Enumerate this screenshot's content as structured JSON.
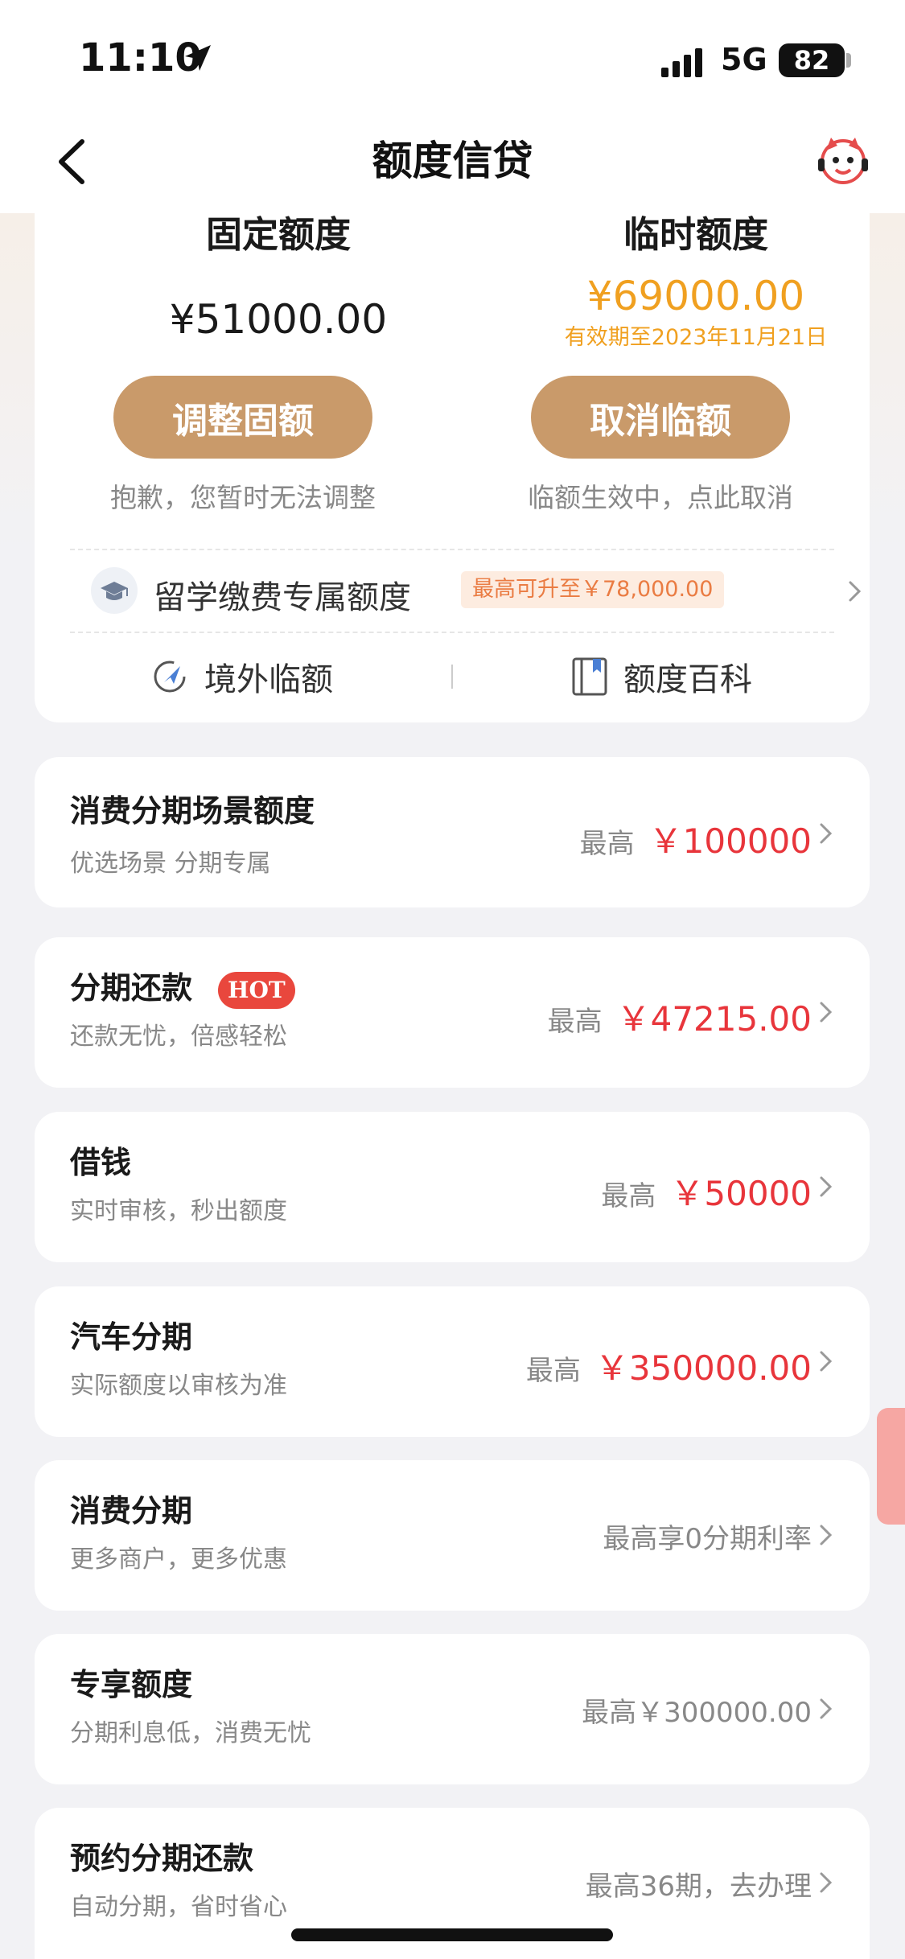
{
  "status_bar": {
    "time": "11:10",
    "network": "5G",
    "battery": "82",
    "icons": [
      "location-arrow-icon",
      "signal-icon",
      "battery-icon"
    ]
  },
  "nav": {
    "title": "额度信贷",
    "icons": [
      "back-chevron-icon",
      "assistant-mascot-icon"
    ]
  },
  "quota": {
    "fixed": {
      "label": "固定额度",
      "amount": "¥51000.00",
      "button": "调整固额",
      "note": "抱歉，您暂时无法调整"
    },
    "temporary": {
      "label": "临时额度",
      "amount": "¥69000.00",
      "expiry": "有效期至2023年11月21日",
      "button": "取消临额",
      "note": "临额生效中，点此取消"
    },
    "study_abroad": {
      "label": "留学缴费专属额度",
      "badge": "最高可升至￥78,000.00"
    },
    "tools": {
      "overseas": "境外临额",
      "wiki": "额度百科"
    }
  },
  "entries": [
    {
      "title": "消费分期场景额度",
      "subtitle": "优选场景 分期专属",
      "prefix": "最高",
      "amount": "￥100000"
    },
    {
      "title": "分期还款",
      "badge": "HOT",
      "subtitle": "还款无忧，倍感轻松",
      "prefix": "最高",
      "amount": "￥47215.00"
    },
    {
      "title": "借钱",
      "subtitle": "实时审核，秒出额度",
      "prefix": "最高",
      "amount": "￥50000"
    },
    {
      "title": "汽车分期",
      "subtitle": "实际额度以审核为准",
      "prefix": "最高",
      "amount": "￥350000.00"
    },
    {
      "title": "消费分期",
      "subtitle": "更多商户，更多优惠",
      "plain": "最高享0分期利率"
    },
    {
      "title": "专享额度",
      "subtitle": "分期利息低，消费无忧",
      "plain": "最高￥300000.00"
    },
    {
      "title": "预约分期还款",
      "subtitle": "自动分期，省时省心",
      "plain": "最高36期，去办理"
    }
  ],
  "colors": {
    "accent_gold": "#c99a6a",
    "temp_orange": "#f0a020",
    "amount_red": "#e8353b",
    "hot_red": "#e9473d"
  }
}
